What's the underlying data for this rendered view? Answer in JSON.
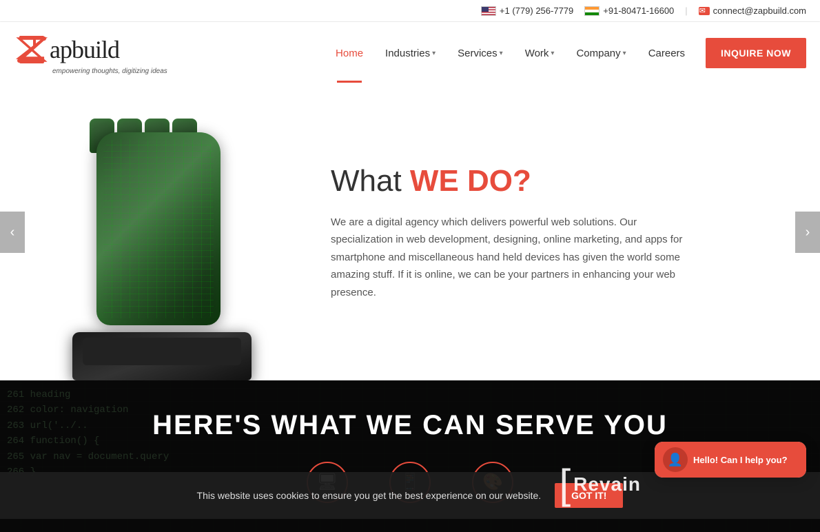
{
  "topbar": {
    "phone_us": "+1 (779) 256-7779",
    "phone_in": "+91-80471-16600",
    "email": "connect@zapbuild.com",
    "separator": "|"
  },
  "header": {
    "logo_text": "apbuild",
    "logo_tagline": "empowering thoughts, digitizing ideas",
    "nav": {
      "home": "Home",
      "industries": "Industries",
      "services": "Services",
      "work": "Work",
      "company": "Company",
      "careers": "Careers"
    },
    "inquire_btn": "INQUIRE NOW"
  },
  "hero": {
    "title_plain": "What ",
    "title_accent": "WE DO?",
    "description": "We are a digital agency which delivers powerful web solutions. Our specialization in web development, designing, online marketing, and apps for smartphone and miscellaneous hand held devices has given the world some amazing stuff. If it is online, we can be your partners in enhancing your web presence.",
    "prev_btn": "‹",
    "next_btn": "›"
  },
  "serve_section": {
    "title": "HERE'S WHAT WE CAN SERVE YOU",
    "bg_lines": "261  heading\n262  color: navigation\n263  url('../.."
  },
  "cookie": {
    "text": "This website uses cookies to ensure you get the best experience on our website.",
    "btn": "GOT IT!"
  },
  "chat": {
    "greeting": "Hello! Can I help you?",
    "avatar_icon": "👤"
  },
  "revain": {
    "text": "Revain"
  }
}
